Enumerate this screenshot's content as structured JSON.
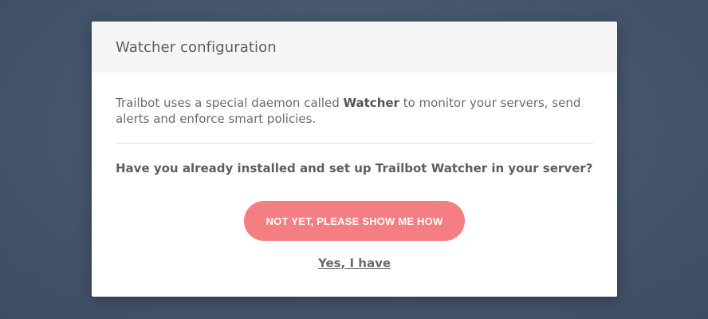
{
  "modal": {
    "title": "Watcher configuration",
    "intro_before": "Trailbot uses a special daemon called ",
    "intro_bold": "Watcher",
    "intro_after": " to monitor your servers, send alerts and enforce smart policies.",
    "question": "Have you already installed and set up Trailbot Watcher in your server?",
    "primary_button_label": "NOT YET, PLEASE SHOW ME HOW",
    "secondary_link_label": "Yes, I have"
  },
  "colors": {
    "background": "#46576e",
    "header_bg": "#f5f5f5",
    "primary_button": "#f47e82",
    "text": "#6b6b6b"
  }
}
